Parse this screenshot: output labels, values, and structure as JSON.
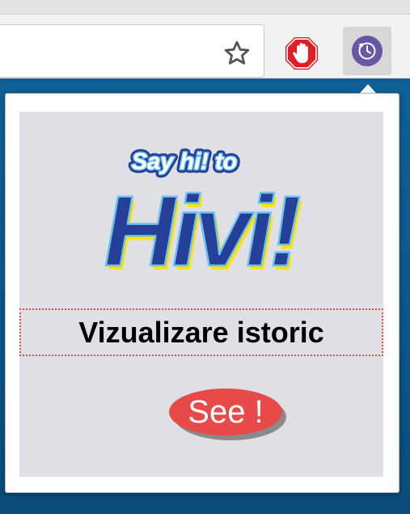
{
  "toolbar": {
    "star_icon": "star-outline-icon",
    "adblock_icon": "adblock-hand-icon",
    "extension_icon": "clock-icon"
  },
  "popup": {
    "logo": {
      "tagline": "Say hi! to",
      "brand": "Hivi!"
    },
    "history_label": "Vizualizare istoric",
    "see_label": "See !"
  },
  "colors": {
    "desktop": "#0f5f95",
    "panel": "#dfe0e6",
    "see_button": "#e84a49",
    "dotted_border": "#e24b43",
    "brand_blue": "#26409a",
    "brand_yellow": "#ffe20a",
    "extension_purple": "#6a56a8"
  }
}
